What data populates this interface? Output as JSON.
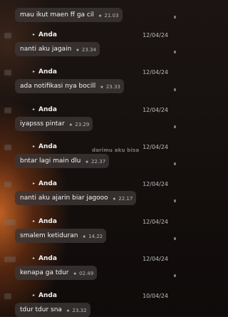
{
  "watermark": "darimu aku bisa",
  "messages": [
    {
      "show_header": false,
      "sender": "",
      "date": "",
      "text": "mau ikut maen ff ga cil",
      "time": "21.03"
    },
    {
      "show_header": true,
      "sender": "Anda",
      "date": "12/04/24",
      "text": "nanti aku jagain",
      "time": "23.34"
    },
    {
      "show_header": true,
      "sender": "Anda",
      "date": "12/04/24",
      "text": "ada notifikasi nya bocill",
      "time": "23.33"
    },
    {
      "show_header": true,
      "sender": "Anda",
      "date": "12/04/24",
      "text": "iyapsss pintar",
      "time": "23.29"
    },
    {
      "show_header": true,
      "sender": "Anda",
      "date": "12/04/24",
      "text": "bntar lagi main dlu",
      "time": "22.37"
    },
    {
      "show_header": true,
      "sender": "Anda",
      "date": "12/04/24",
      "text": "nanti aku ajarin biar jagooo",
      "time": "22.17"
    },
    {
      "show_header": true,
      "sender": "Anda",
      "date": "12/04/24",
      "text": "smalem ketiduran",
      "time": "14.22"
    },
    {
      "show_header": true,
      "sender": "Anda",
      "date": "12/04/24",
      "text": "kenapa ga tdur",
      "time": "02.49"
    },
    {
      "show_header": true,
      "sender": "Anda",
      "date": "10/04/24",
      "text": "tdur tdur sna",
      "time": "23.32"
    }
  ]
}
